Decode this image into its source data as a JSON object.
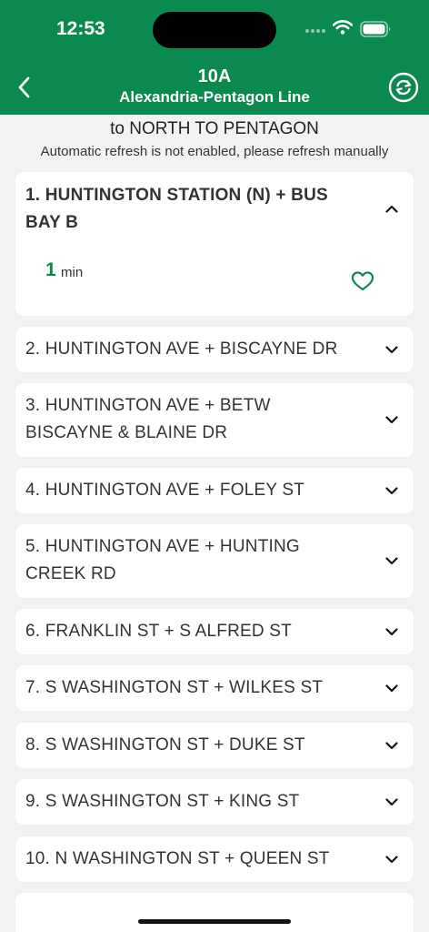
{
  "status": {
    "time": "12:53"
  },
  "header": {
    "route_number": "10A",
    "route_name": "Alexandria-Pentagon Line"
  },
  "direction": "to NORTH TO PENTAGON",
  "notice": "Automatic refresh is not enabled, please refresh manually",
  "stops": [
    {
      "name": "1. HUNTINGTON STATION (N) + BUS BAY B",
      "expanded": true,
      "eta_value": "1",
      "eta_unit": "min"
    },
    {
      "name": "2. HUNTINGTON AVE + BISCAYNE DR"
    },
    {
      "name": "3. HUNTINGTON AVE + BETW BISCAYNE & BLAINE DR"
    },
    {
      "name": "4. HUNTINGTON AVE + FOLEY ST"
    },
    {
      "name": "5. HUNTINGTON AVE + HUNTING CREEK RD"
    },
    {
      "name": "6. FRANKLIN ST + S ALFRED ST"
    },
    {
      "name": "7. S WASHINGTON ST + WILKES ST"
    },
    {
      "name": "8. S WASHINGTON ST + DUKE ST"
    },
    {
      "name": "9. S WASHINGTON ST + KING ST"
    },
    {
      "name": "10. N WASHINGTON ST + QUEEN ST"
    }
  ],
  "colors": {
    "brand_green": "#0b8a4f",
    "background": "#f2f2f2",
    "card": "#ffffff"
  },
  "icons": {
    "back": "chevron-left-icon",
    "refresh": "refresh-cycle-icon",
    "expand": "chevron-down-icon",
    "collapse": "chevron-up-icon",
    "favorite": "heart-outline-icon"
  }
}
